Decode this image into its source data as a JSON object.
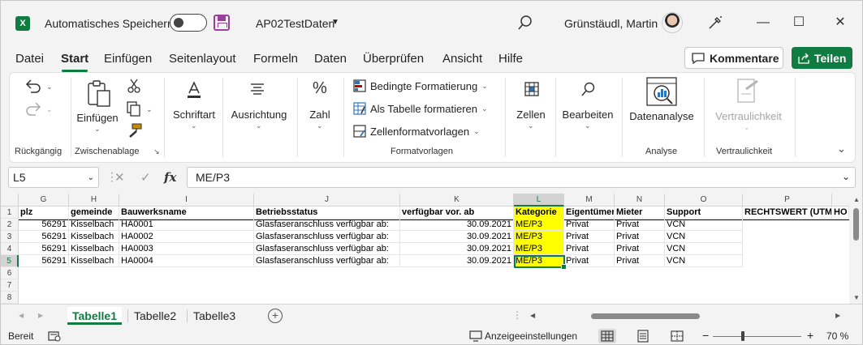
{
  "title_bar": {
    "autosave_label": "Automatisches Speichern",
    "filename": "AP02TestDaten",
    "user": "Grünstäudl, Martin",
    "app_logo": "X",
    "accent": "#107c41"
  },
  "menu": {
    "tabs": [
      "Datei",
      "Start",
      "Einfügen",
      "Seitenlayout",
      "Formeln",
      "Daten",
      "Überprüfen",
      "Ansicht",
      "Hilfe"
    ],
    "active": "Start",
    "comment_label": "Kommentare",
    "share_label": "Teilen"
  },
  "ribbon": {
    "undo_group": "Rückgängig",
    "clipboard_group": "Zwischenablage",
    "paste": "Einfügen",
    "font": "Schriftart",
    "alignment": "Ausrichtung",
    "number": "Zahl",
    "cond_format": "Bedingte Formatierung",
    "as_table": "Als Tabelle formatieren",
    "cell_styles": "Zellenformatvorlagen",
    "styles_group": "Formatvorlagen",
    "cells": "Zellen",
    "editing": "Bearbeiten",
    "data_analysis": "Datenanalyse",
    "analysis_group": "Analyse",
    "sensitivity": "Vertraulichkeit",
    "sensitivity_group": "Vertraulichkeit"
  },
  "formula_bar": {
    "name_box": "L5",
    "fx": "fx",
    "value": "ME/P3"
  },
  "grid": {
    "columns": [
      "G",
      "H",
      "I",
      "J",
      "K",
      "L",
      "M",
      "N",
      "O",
      "P"
    ],
    "selected_column": "L",
    "rows": [
      "1",
      "2",
      "3",
      "4",
      "5",
      "6",
      "7",
      "8"
    ],
    "selected_row": "5",
    "headers": [
      "plz",
      "gemeinde",
      "Bauwerksname",
      "Betriebsstatus",
      "verfügbar vor. ab",
      "Kategorie",
      "Eigentümer",
      "Mieter",
      "Support",
      "RECHTSWERT (UTM)",
      "HO"
    ],
    "data": [
      [
        "56291",
        "Kisselbach",
        "HA0001",
        "Glasfaseranschluss verfügbar ab:",
        "30.09.2021",
        "ME/P3",
        "Privat",
        "Privat",
        "VCN"
      ],
      [
        "56291",
        "Kisselbach",
        "HA0002",
        "Glasfaseranschluss verfügbar ab:",
        "30.09.2021",
        "ME/P3",
        "Privat",
        "Privat",
        "VCN"
      ],
      [
        "56291",
        "Kisselbach",
        "HA0003",
        "Glasfaseranschluss verfügbar ab:",
        "30.09.2021",
        "ME/P3",
        "Privat",
        "Privat",
        "VCN"
      ],
      [
        "56291",
        "Kisselbach",
        "HA0004",
        "Glasfaseranschluss verfügbar ab:",
        "30.09.2021",
        "ME/P3",
        "Privat",
        "Privat",
        "VCN"
      ]
    ],
    "highlight_color": "#ffff00"
  },
  "sheets": {
    "tabs": [
      "Tabelle1",
      "Tabelle2",
      "Tabelle3"
    ],
    "active": "Tabelle1"
  },
  "status_bar": {
    "ready": "Bereit",
    "display_settings": "Anzeigeeinstellungen",
    "zoom": "70 %"
  }
}
